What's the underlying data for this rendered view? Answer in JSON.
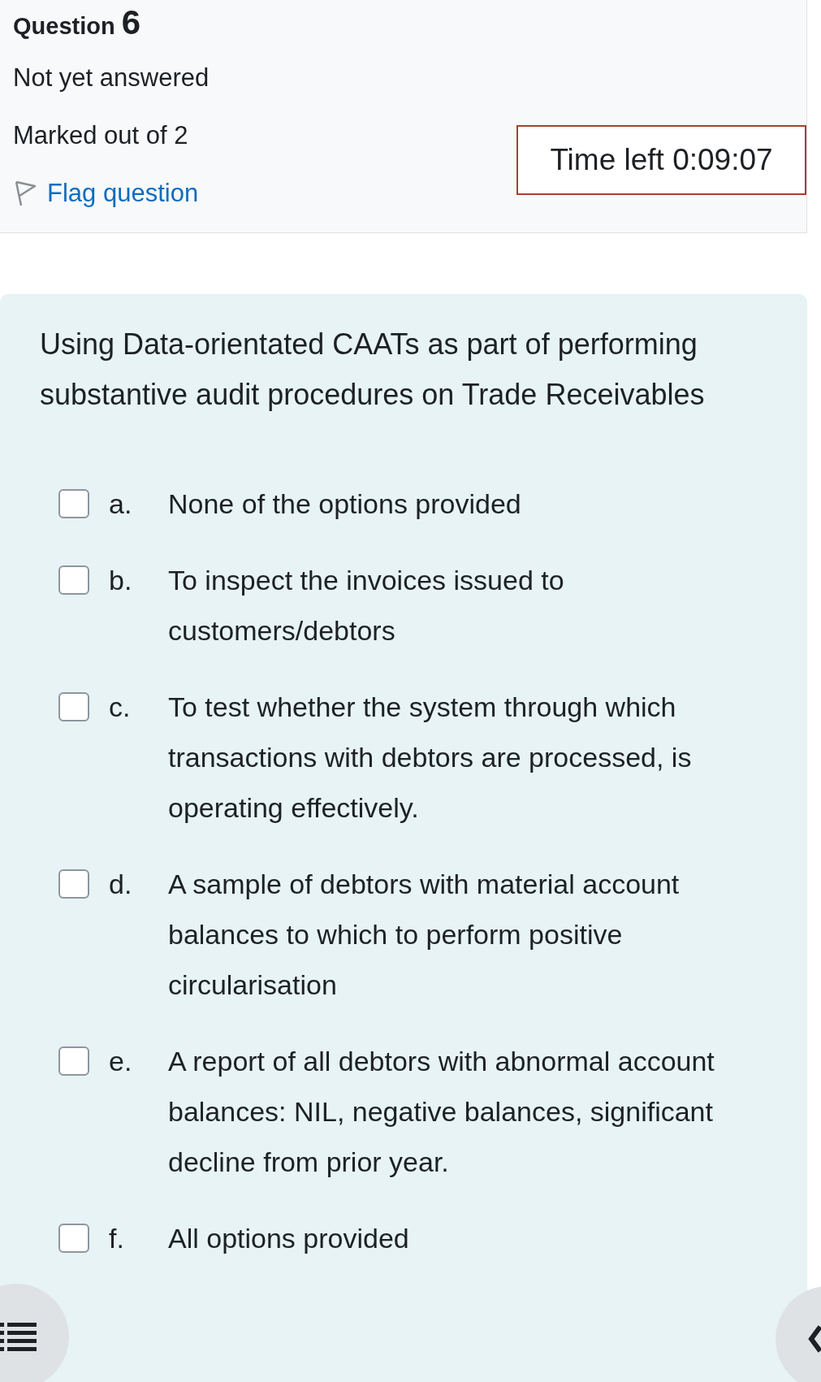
{
  "question_label": "Question",
  "question_number": "6",
  "status": "Not yet answered",
  "marks": "Marked out of 2",
  "flag_link": "Flag question",
  "timer": "Time left 0:09:07",
  "question_text": "Using Data-orientated CAATs as part of performing substantive audit procedures on Trade Receivables",
  "options": [
    {
      "letter": "a.",
      "text": "None of the options provided",
      "checked": false
    },
    {
      "letter": "b.",
      "text": "To inspect the invoices issued to customers/debtors",
      "checked": false
    },
    {
      "letter": "c.",
      "text": "To test whether the system through which transactions with debtors are processed, is operating effectively.",
      "checked": false
    },
    {
      "letter": "d.",
      "text": "A sample of debtors with material account balances to which to perform positive circularisation",
      "checked": false
    },
    {
      "letter": "e.",
      "text": "A report of all debtors with abnormal account balances: NIL, negative balances, significant decline from prior year.",
      "checked": false
    },
    {
      "letter": "f.",
      "text": "All options provided",
      "checked": false
    }
  ]
}
